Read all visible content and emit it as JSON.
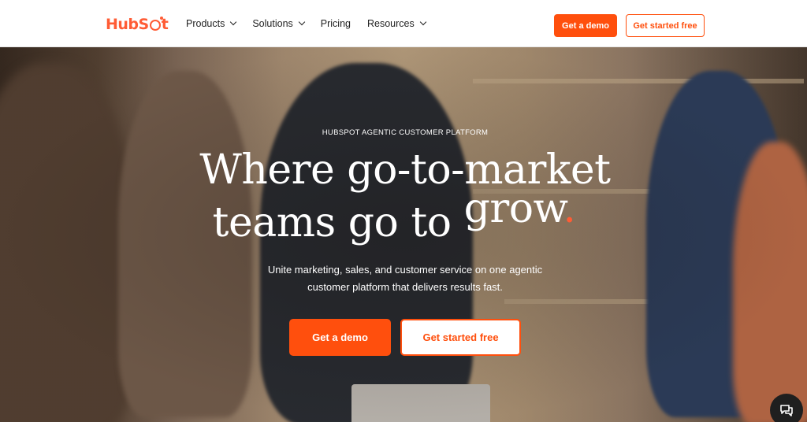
{
  "nav": {
    "logo_text": "HubSpot",
    "menu": [
      {
        "label": "Products",
        "has_dropdown": true
      },
      {
        "label": "Solutions",
        "has_dropdown": true
      },
      {
        "label": "Pricing",
        "has_dropdown": false
      },
      {
        "label": "Resources",
        "has_dropdown": true
      }
    ],
    "demo_button": "Get a demo",
    "free_button": "Get started free"
  },
  "hero": {
    "eyebrow": "HUBSPOT AGENTIC CUSTOMER PLATFORM",
    "headline_line1": "Where go-to-market",
    "headline_line2_part1": "teams go to",
    "headline_line2_part2": "grow",
    "headline_dot": ".",
    "subtitle_line1": "Unite marketing, sales, and customer service on one agentic",
    "subtitle_line2": "customer platform that delivers results fast.",
    "primary_cta": "Get a demo",
    "secondary_cta": "Get started free"
  },
  "icons": {
    "chat": "chat-bubble-icon",
    "chevron": "chevron-down-icon",
    "logo_sprocket": "sprocket-icon"
  },
  "colors": {
    "brand_orange": "#ff4f0d",
    "logo_orange": "#ff5c35",
    "text_dark": "#1f1f1f"
  }
}
